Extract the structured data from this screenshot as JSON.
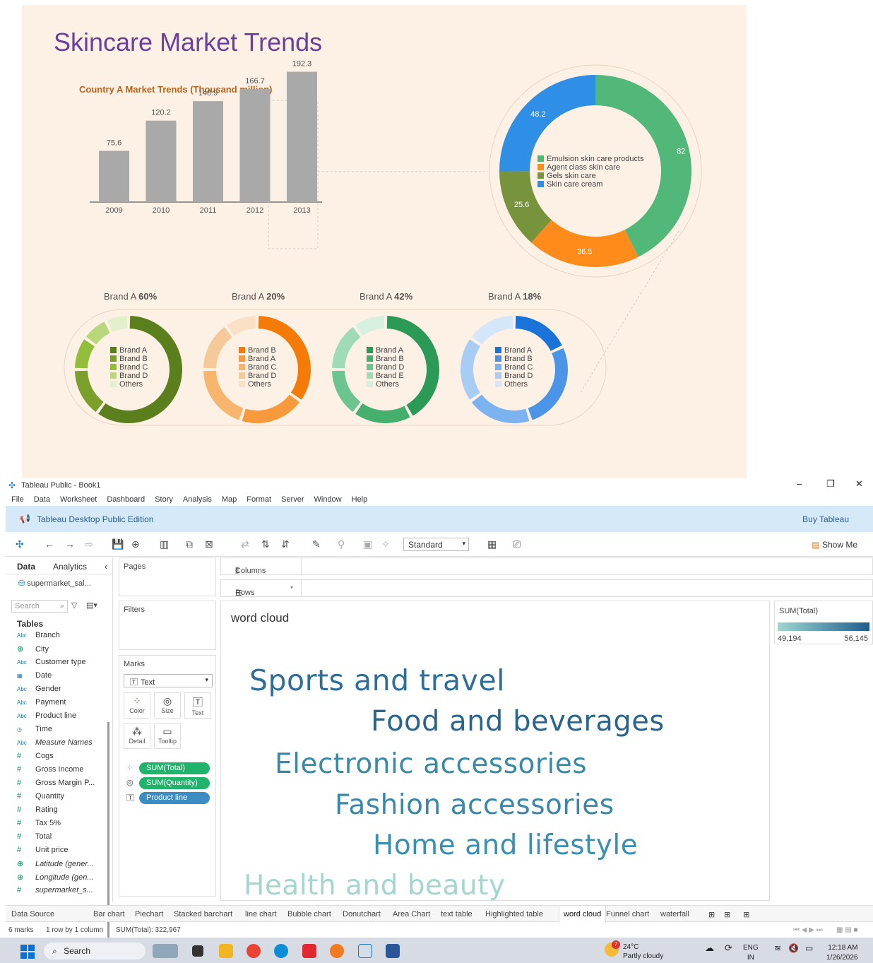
{
  "poster": {
    "title": "Skincare Market Trends",
    "chart_title": "Country A Market Trends (Thousand million)",
    "brand_labels": [
      {
        "text": "Brand A ",
        "pct": "60%"
      },
      {
        "text": "Brand A ",
        "pct": "20%"
      },
      {
        "text": "Brand A ",
        "pct": "42%"
      },
      {
        "text": "Brand A ",
        "pct": "18%"
      }
    ],
    "donut_legend": [
      "Emulsion skin care products",
      "Agent class skin care",
      "Gels skin care",
      "Skin care cream"
    ],
    "small_legends": [
      [
        "Brand A",
        "Brand B",
        "Brand C",
        "Brand D",
        "Others"
      ],
      [
        "Brand B",
        "Brand A",
        "Brand C",
        "Brand D",
        "Others"
      ],
      [
        "Brand A",
        "Brand B",
        "Brand D",
        "Brand E",
        "Others"
      ],
      [
        "Brand A",
        "Brand B",
        "Brand C",
        "Brand D",
        "Others"
      ]
    ],
    "colors": {
      "bar": "#a9a9a9",
      "emulsion": "#52b87a",
      "agent": "#ff8c1a",
      "gels": "#77933c",
      "cream": "#2f8fe6"
    }
  },
  "chart_data": [
    {
      "type": "bar",
      "title": "Country A Market Trends (Thousand million)",
      "categories": [
        "2009",
        "2010",
        "2011",
        "2012",
        "2013"
      ],
      "values": [
        75.6,
        120.2,
        148.9,
        166.7,
        192.3
      ],
      "ylim": [
        0,
        200
      ],
      "grid": false
    },
    {
      "type": "pie",
      "labels": [
        "Emulsion skin care products",
        "Agent class skin care",
        "Gels skin care",
        "Skin care cream"
      ],
      "values": [
        82,
        36.5,
        25.6,
        48.2
      ],
      "legend": "center"
    },
    {
      "type": "pie",
      "labels": [
        "Brand A",
        "Brand B",
        "Brand C",
        "Brand D",
        "Others"
      ],
      "values": [
        60,
        15,
        10,
        8,
        7
      ]
    },
    {
      "type": "pie",
      "labels": [
        "Brand B",
        "Brand A",
        "Brand C",
        "Brand D",
        "Others"
      ],
      "values": [
        35,
        20,
        20,
        15,
        10
      ]
    },
    {
      "type": "pie",
      "labels": [
        "Brand A",
        "Brand B",
        "Brand D",
        "Brand E",
        "Others"
      ],
      "values": [
        42,
        18,
        15,
        15,
        10
      ]
    },
    {
      "type": "pie",
      "labels": [
        "Brand A",
        "Brand B",
        "Brand C",
        "Brand D",
        "Others"
      ],
      "values": [
        18,
        27,
        20,
        20,
        15
      ]
    }
  ],
  "app": {
    "window_title": "Tableau Public - Book1",
    "menu": [
      "File",
      "Data",
      "Worksheet",
      "Dashboard",
      "Story",
      "Analysis",
      "Map",
      "Format",
      "Server",
      "Window",
      "Help"
    ],
    "banner": {
      "edition": "Tableau Desktop Public Edition",
      "buy": "Buy Tableau"
    },
    "toolbar": {
      "fit": "Standard",
      "show_me": "Show Me"
    },
    "left": {
      "tab_data": "Data",
      "tab_analytics": "Analytics",
      "datasource": "supermarket_sal...",
      "search_placeholder": "Search",
      "tables": "Tables",
      "fields": [
        {
          "type": "Abc",
          "name": "Branch"
        },
        {
          "type": "geo",
          "name": "City"
        },
        {
          "type": "Abc",
          "name": "Customer type"
        },
        {
          "type": "date",
          "name": "Date"
        },
        {
          "type": "Abc",
          "name": "Gender"
        },
        {
          "type": "Abc",
          "name": "Payment"
        },
        {
          "type": "Abc",
          "name": "Product line"
        },
        {
          "type": "time",
          "name": "Time"
        },
        {
          "type": "Abc",
          "name": "Measure Names",
          "italic": true
        },
        {
          "type": "#",
          "name": "Cogs"
        },
        {
          "type": "#",
          "name": "Gross Income"
        },
        {
          "type": "#",
          "name": "Gross Margin P..."
        },
        {
          "type": "#",
          "name": "Quantity"
        },
        {
          "type": "#",
          "name": "Rating"
        },
        {
          "type": "#",
          "name": "Tax 5%"
        },
        {
          "type": "#",
          "name": "Total"
        },
        {
          "type": "#",
          "name": "Unit price"
        },
        {
          "type": "geo",
          "name": "Latitude (gener...",
          "italic": true
        },
        {
          "type": "geo",
          "name": "Longitude (gen...",
          "italic": true
        },
        {
          "type": "#",
          "name": "supermarket_s...",
          "italic": true
        }
      ]
    },
    "cards": {
      "pages": "Pages",
      "filters": "Filters",
      "marks": "Marks",
      "mark_type": "Text",
      "buttons": [
        "Color",
        "Size",
        "Text",
        "Detail",
        "Tooltip"
      ],
      "pills": [
        {
          "label": "SUM(Total)",
          "color": "#1fb36b"
        },
        {
          "label": "SUM(Quantity)",
          "color": "#1fb36b"
        },
        {
          "label": "Product line",
          "color": "#3b8dc4"
        }
      ]
    },
    "shelves": {
      "columns": "Columns",
      "rows": "Rows"
    },
    "viz": {
      "title": "word cloud",
      "words": [
        {
          "text": "Sports and travel",
          "color": "#2f6e99"
        },
        {
          "text": "Food and beverages",
          "color": "#2a6590"
        },
        {
          "text": "Electronic accessories",
          "color": "#3a8aa6"
        },
        {
          "text": "Fashion accessories",
          "color": "#3a87a9"
        },
        {
          "text": "Home and lifestyle",
          "color": "#3b8fb3"
        },
        {
          "text": "Health and beauty",
          "color": "#a3d6d1"
        }
      ]
    },
    "legend": {
      "title": "SUM(Total)",
      "min": "49,194",
      "max": "56,145"
    },
    "sheets": [
      "Data Source",
      "Bar chart",
      "Piechart",
      "Stacked barchart",
      "line chart",
      "Bubble chart",
      "Donutchart",
      "Area Chart",
      "text table",
      "Highlighted table",
      "word cloud",
      "Funnel chart",
      "waterfall"
    ],
    "active_sheet": "word cloud",
    "status": {
      "marks": "6 marks",
      "rows": "1 row by 1 column",
      "sum": "SUM(Total): 322,967"
    }
  },
  "taskbar": {
    "search": "Search",
    "weather_temp": "24°C",
    "weather_desc": "Partly cloudy",
    "weather_badge": "7",
    "lang1": "ENG",
    "lang2": "IN",
    "time": "12:18 AM",
    "date": "1/26/2026"
  }
}
